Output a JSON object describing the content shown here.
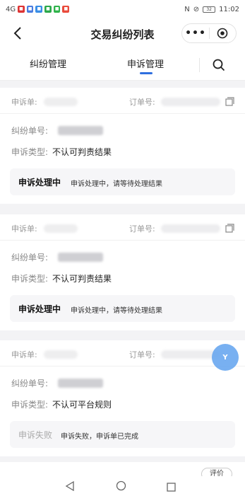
{
  "status_bar": {
    "time": "11:02",
    "signal": "4G",
    "battery": "32"
  },
  "header": {
    "title": "交易纠纷列表",
    "more_label": "•••"
  },
  "tabs": [
    {
      "label": "纠纷管理"
    },
    {
      "label": "申诉管理"
    }
  ],
  "cards": [
    {
      "appeal_no_label": "申诉单:",
      "order_no_label": "订单号:",
      "dispute_no_label": "纠纷单号:",
      "appeal_type_label": "申诉类型:",
      "appeal_type_value": "不认可判责结果",
      "status_title": "申诉处理中",
      "status_desc": "申诉处理中，请等待处理结果"
    },
    {
      "appeal_no_label": "申诉单:",
      "order_no_label": "订单号:",
      "dispute_no_label": "纠纷单号:",
      "appeal_type_label": "申诉类型:",
      "appeal_type_value": "不认可判责结果",
      "status_title": "申诉处理中",
      "status_desc": "申诉处理中，请等待处理结果"
    },
    {
      "appeal_no_label": "申诉单:",
      "order_no_label": "订单号:",
      "dispute_no_label": "纠纷单号:",
      "appeal_type_label": "申诉类型:",
      "appeal_type_value": "不认可平台规则",
      "status_title": "申诉失败",
      "status_desc": "申诉失败，申诉单已完成"
    }
  ],
  "partial_button": "评价",
  "float_button": "Y"
}
